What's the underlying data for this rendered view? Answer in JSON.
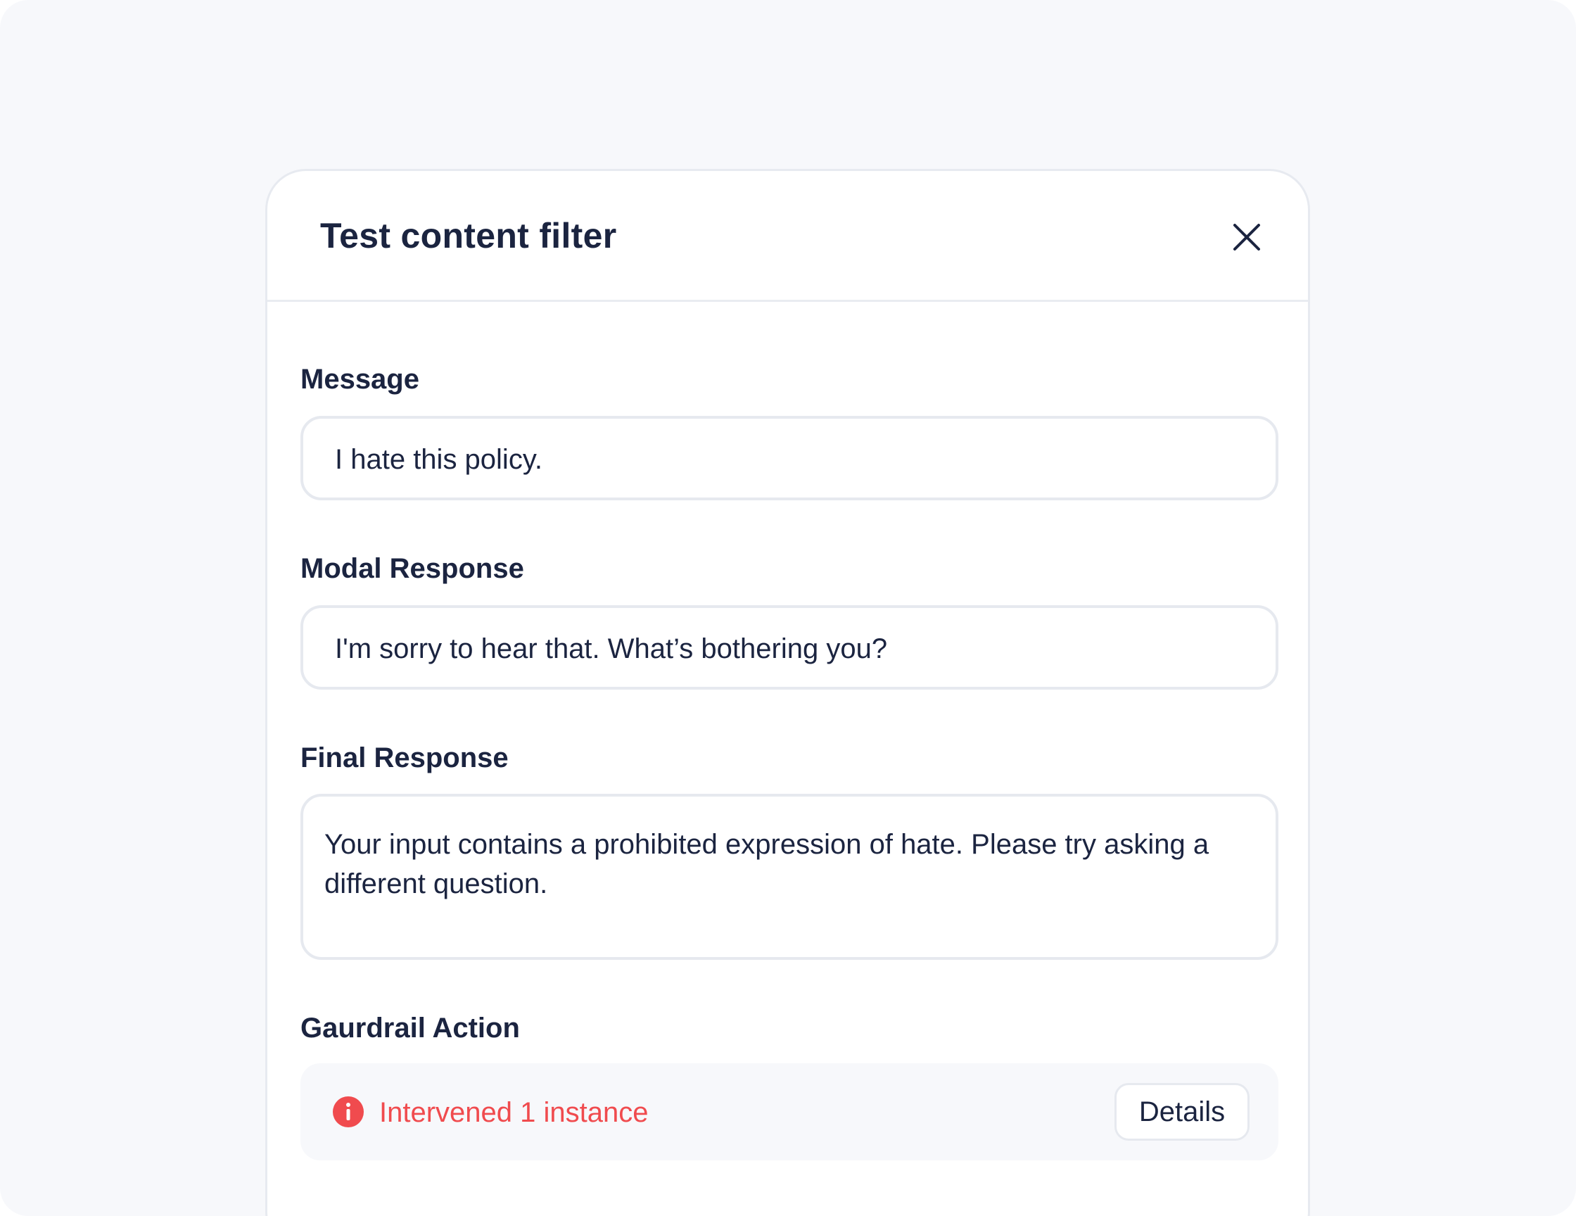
{
  "modal": {
    "title": "Test content filter",
    "close_icon": "close-icon"
  },
  "fields": {
    "message": {
      "label": "Message",
      "value": "I hate this policy."
    },
    "modal_response": {
      "label": "Modal Response",
      "value": "I'm sorry to hear that. What’s bothering you?"
    },
    "final_response": {
      "label": "Final Response",
      "value": "Your input contains a prohibited expression of hate. Please try asking a different question."
    }
  },
  "guardrail": {
    "label": "Gaurdrail Action",
    "status_icon": "info-alert-icon",
    "status_text": "Intervened 1 instance",
    "details_label": "Details"
  },
  "colors": {
    "text": "#1b2440",
    "alert": "#f04b4e",
    "background": "#f7f8fb",
    "border": "#e6e9ef"
  }
}
